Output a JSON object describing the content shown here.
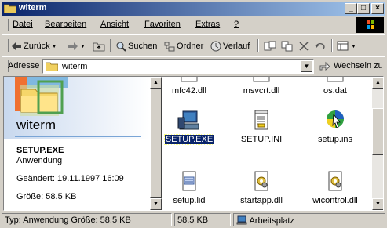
{
  "window": {
    "title": "witerm",
    "controls": [
      "_",
      "□",
      "×"
    ]
  },
  "menu": [
    "Datei",
    "Bearbeiten",
    "Ansicht",
    "Favoriten",
    "Extras",
    "?"
  ],
  "toolbar": {
    "back": "Zurück",
    "search": "Suchen",
    "folders": "Ordner",
    "history": "Verlauf"
  },
  "address": {
    "label": "Adresse",
    "value": "witerm",
    "go": "Wechseln zu"
  },
  "details": {
    "brand": "witerm",
    "name": "SETUP.EXE",
    "type": "Anwendung",
    "modified": "Geändert: 19.11.1997 16:09",
    "size": "Größe: 58.5 KB"
  },
  "files": [
    {
      "name": "mfc42.dll",
      "icon": "dll-icon"
    },
    {
      "name": "msvcrt.dll",
      "icon": "dll-icon"
    },
    {
      "name": "os.dat",
      "icon": "file-icon"
    },
    {
      "name": "SETUP.EXE",
      "icon": "computer-icon",
      "selected": true
    },
    {
      "name": "SETUP.INI",
      "icon": "ini-icon"
    },
    {
      "name": "setup.ins",
      "icon": "installshield-icon"
    },
    {
      "name": "setup.lid",
      "icon": "lid-icon"
    },
    {
      "name": "startapp.dll",
      "icon": "dll-icon"
    },
    {
      "name": "wicontrol.dll",
      "icon": "dll-icon"
    }
  ],
  "status": {
    "info": "Typ: Anwendung Größe: 58.5 KB",
    "size": "58.5 KB",
    "zone": "Arbeitsplatz"
  },
  "colors": {
    "titlebar": "#0a246a",
    "selection": "#0a246a",
    "face": "#d4d0c8"
  }
}
